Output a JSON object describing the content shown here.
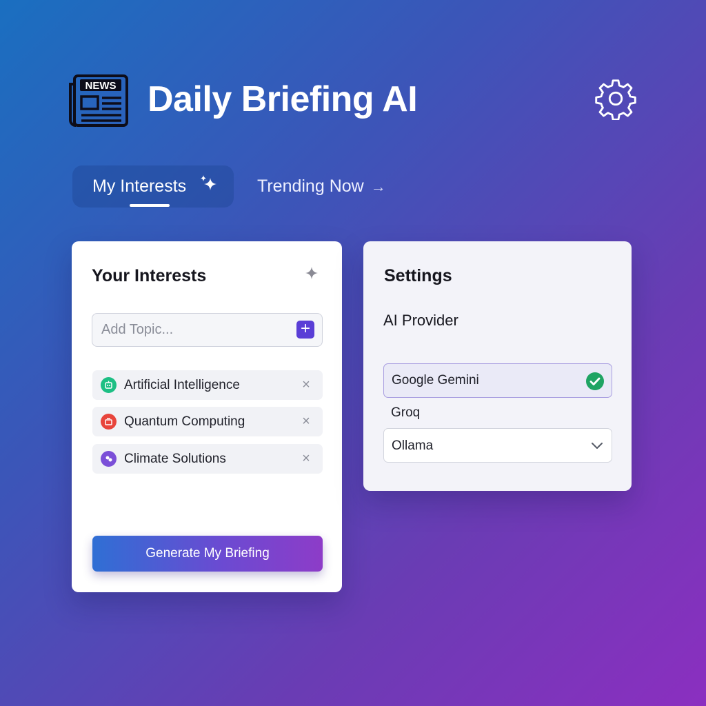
{
  "app": {
    "title": "Daily Briefing AI",
    "logo_text": "NEWS"
  },
  "tabs": [
    {
      "label": "My Interests",
      "active": true
    },
    {
      "label": "Trending Now",
      "active": false
    }
  ],
  "interests": {
    "title": "Your Interests",
    "add_placeholder": "Add Topic...",
    "add_icon": "+",
    "topics": [
      {
        "name": "Artificial Intelligence",
        "color": "#1dbf84",
        "icon": "robot-icon"
      },
      {
        "name": "Quantum Computing",
        "color": "#e8453c",
        "icon": "atom-icon"
      },
      {
        "name": "Climate Solutions",
        "color": "#7b4fd8",
        "icon": "leaf-icon"
      }
    ],
    "remove_icon": "×",
    "generate_label": "Generate My Briefing"
  },
  "settings": {
    "title": "Settings",
    "provider_label": "AI Provider",
    "options": [
      "Google Gemini",
      "Groq"
    ],
    "selected": "Google Gemini",
    "dropdown_value": "Ollama"
  },
  "colors": {
    "accent": "#5a3ed6",
    "check": "#1fa463"
  }
}
